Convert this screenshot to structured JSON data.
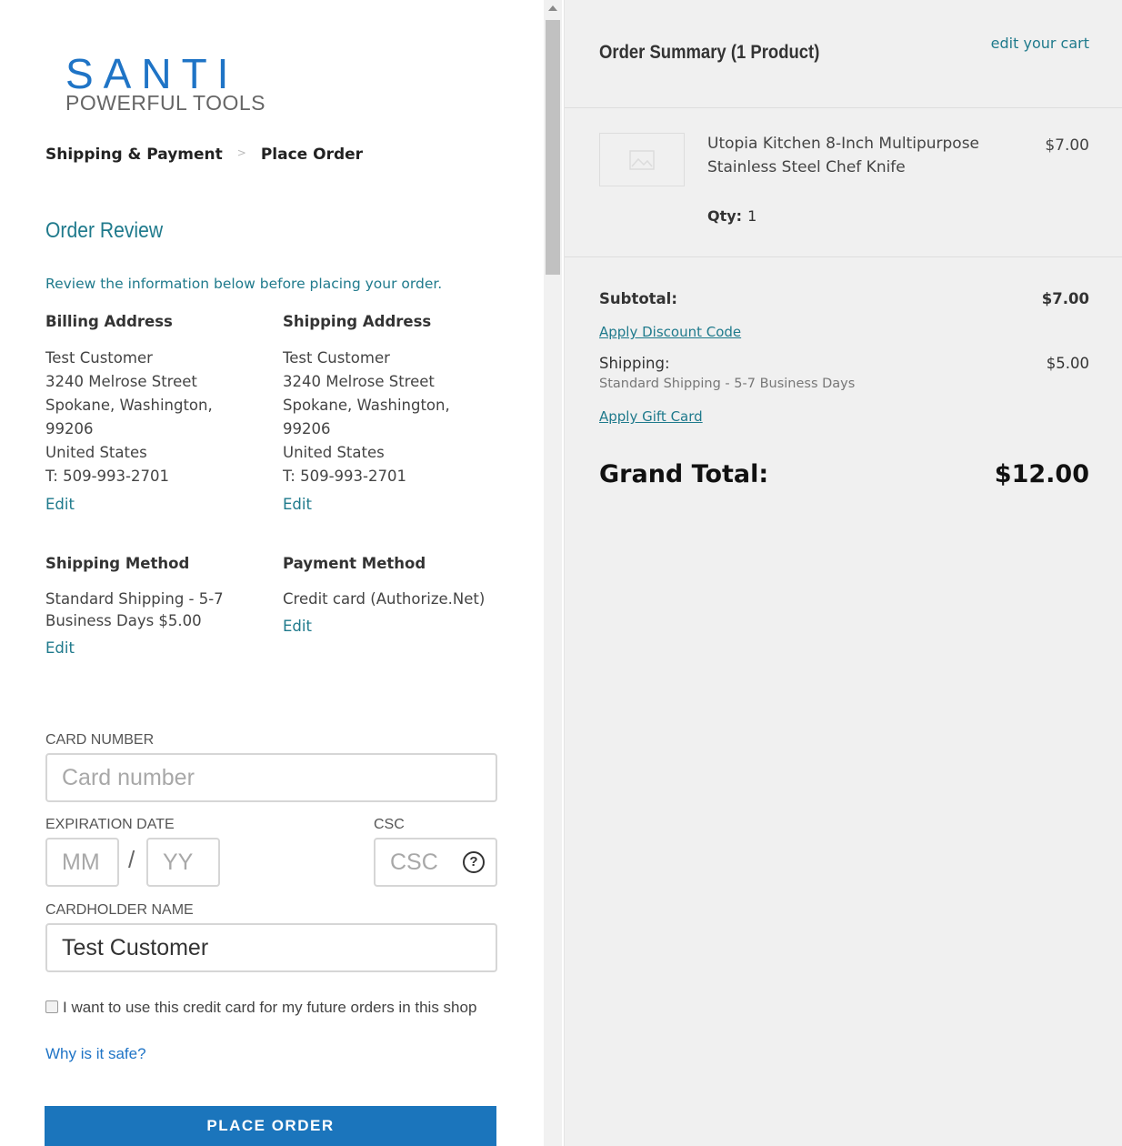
{
  "brand": {
    "name": "SANTI",
    "tagline": "POWERFUL TOOLS"
  },
  "breadcrumb": {
    "step1": "Shipping & Payment",
    "separator": ">",
    "step2": "Place Order"
  },
  "review": {
    "title": "Order Review",
    "note": "Review the information below before placing your order.",
    "billing": {
      "heading": "Billing Address",
      "lines": [
        "Test Customer",
        "3240 Melrose Street",
        "Spokane, Washington,",
        "99206",
        "United States",
        "T: 509-993-2701"
      ],
      "edit": "Edit"
    },
    "shipping": {
      "heading": "Shipping Address",
      "lines": [
        "Test Customer",
        "3240 Melrose Street",
        "Spokane, Washington,",
        "99206",
        "United States",
        "T: 509-993-2701"
      ],
      "edit": "Edit"
    },
    "shipping_method": {
      "heading": "Shipping Method",
      "lines": [
        "Standard Shipping - 5-7",
        "Business Days $5.00"
      ],
      "edit": "Edit"
    },
    "payment_method": {
      "heading": "Payment Method",
      "lines": [
        "Credit card (Authorize.Net)"
      ],
      "edit": "Edit"
    }
  },
  "card_form": {
    "card_number_label": "CARD NUMBER",
    "card_number_placeholder": "Card number",
    "expiration_label": "EXPIRATION DATE",
    "month_placeholder": "MM",
    "expiry_separator": "/",
    "year_placeholder": "YY",
    "csc_label": "CSC",
    "csc_placeholder": "CSC",
    "csc_help_icon": "?",
    "cardholder_label": "CARDHOLDER NAME",
    "cardholder_value": "Test Customer",
    "save_card_text": "I want to use this credit card for my future orders in this shop",
    "save_card_checked": false,
    "why_safe": "Why is it safe?",
    "place_order": "PLACE ORDER"
  },
  "summary": {
    "title": "Order Summary (1 Product)",
    "edit_cart": "edit your cart",
    "product": {
      "name": "Utopia Kitchen 8-Inch Multipurpose Stainless Steel Chef Knife",
      "qty_label": "Qty:",
      "qty": "1",
      "price": "$7.00",
      "image_icon": "image-placeholder-icon"
    },
    "subtotal_label": "Subtotal:",
    "subtotal": "$7.00",
    "discount_link": "Apply Discount Code",
    "shipping_label": "Shipping:",
    "shipping_value": "$5.00",
    "shipping_note": "Standard Shipping - 5-7 Business Days",
    "gift_card_link": "Apply Gift Card",
    "grand_total_label": "Grand Total:",
    "grand_total": "$12.00"
  },
  "colors": {
    "brand_blue": "#1f74c6",
    "teal_link": "#1f7a8c",
    "button_blue": "#1b75bc",
    "summary_bg": "#f0f0f0"
  }
}
